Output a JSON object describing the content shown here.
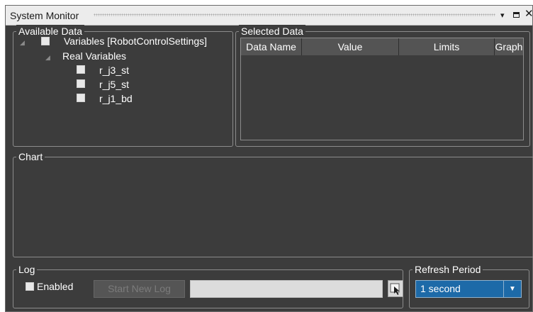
{
  "window": {
    "title": "System Monitor",
    "menu_glyph": "▾",
    "close_glyph": "✕"
  },
  "available": {
    "legend": "Available Data",
    "expander_glyph": "◢",
    "root_label": "Variables [RobotControlSettings]",
    "group_label": "Real Variables",
    "variables": [
      "r_j3_st",
      "r_j5_st",
      "r_j1_bd"
    ]
  },
  "selected": {
    "legend": "Selected Data",
    "columns": [
      "Data Name",
      "Value",
      "Limits",
      "Graph"
    ]
  },
  "chart": {
    "legend": "Chart"
  },
  "log": {
    "legend": "Log",
    "enabled_label": "Enabled",
    "enabled_checked": false,
    "start_button": "Start New Log",
    "path_value": ""
  },
  "refresh": {
    "legend": "Refresh Period",
    "selected": "1 second",
    "arrow_glyph": "▼"
  }
}
